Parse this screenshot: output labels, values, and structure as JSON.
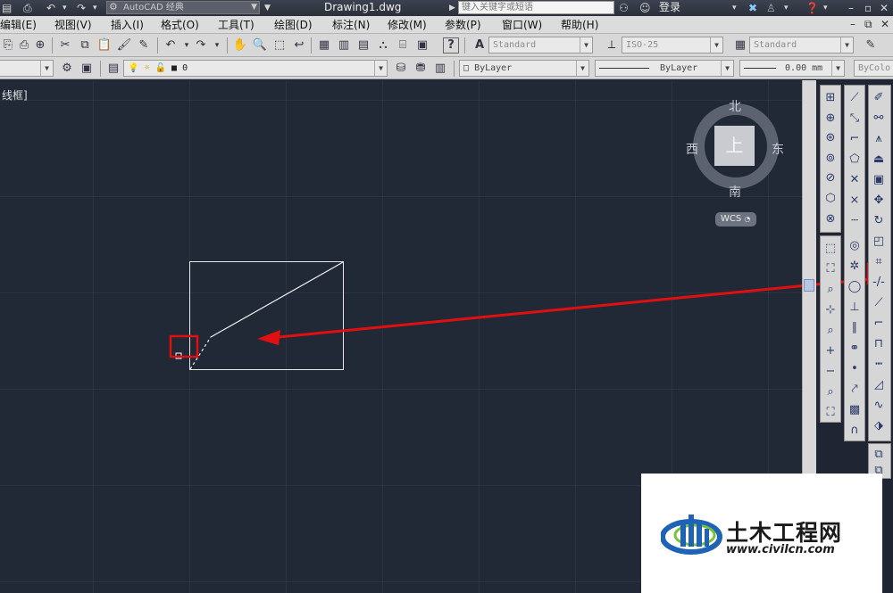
{
  "titlebar": {
    "workspace": "AutoCAD 经典",
    "document_title": "Drawing1.dwg",
    "search_placeholder": "键入关键字或短语",
    "login": "登录"
  },
  "menu": [
    "编辑(E)",
    "视图(V)",
    "插入(I)",
    "格式(O)",
    "工具(T)",
    "绘图(D)",
    "标注(N)",
    "修改(M)",
    "参数(P)",
    "窗口(W)",
    "帮助(H)"
  ],
  "toolbar1": {
    "text_style": "Standard",
    "dim_style": "ISO-25",
    "table_style": "Standard"
  },
  "toolbar2": {
    "layer_value": "0",
    "color": "ByLayer",
    "linetype": "ByLayer",
    "lineweight": "0.00 mm",
    "plot_style": "ByColo"
  },
  "viewport_label": "线框]",
  "viewcube": {
    "face": "上",
    "north": "北",
    "south": "南",
    "east": "东",
    "west": "西",
    "wcs": "WCS"
  },
  "watermark": {
    "title": "土木工程网",
    "url": "www.civilcn.com"
  },
  "annotation_color": "#e01010"
}
